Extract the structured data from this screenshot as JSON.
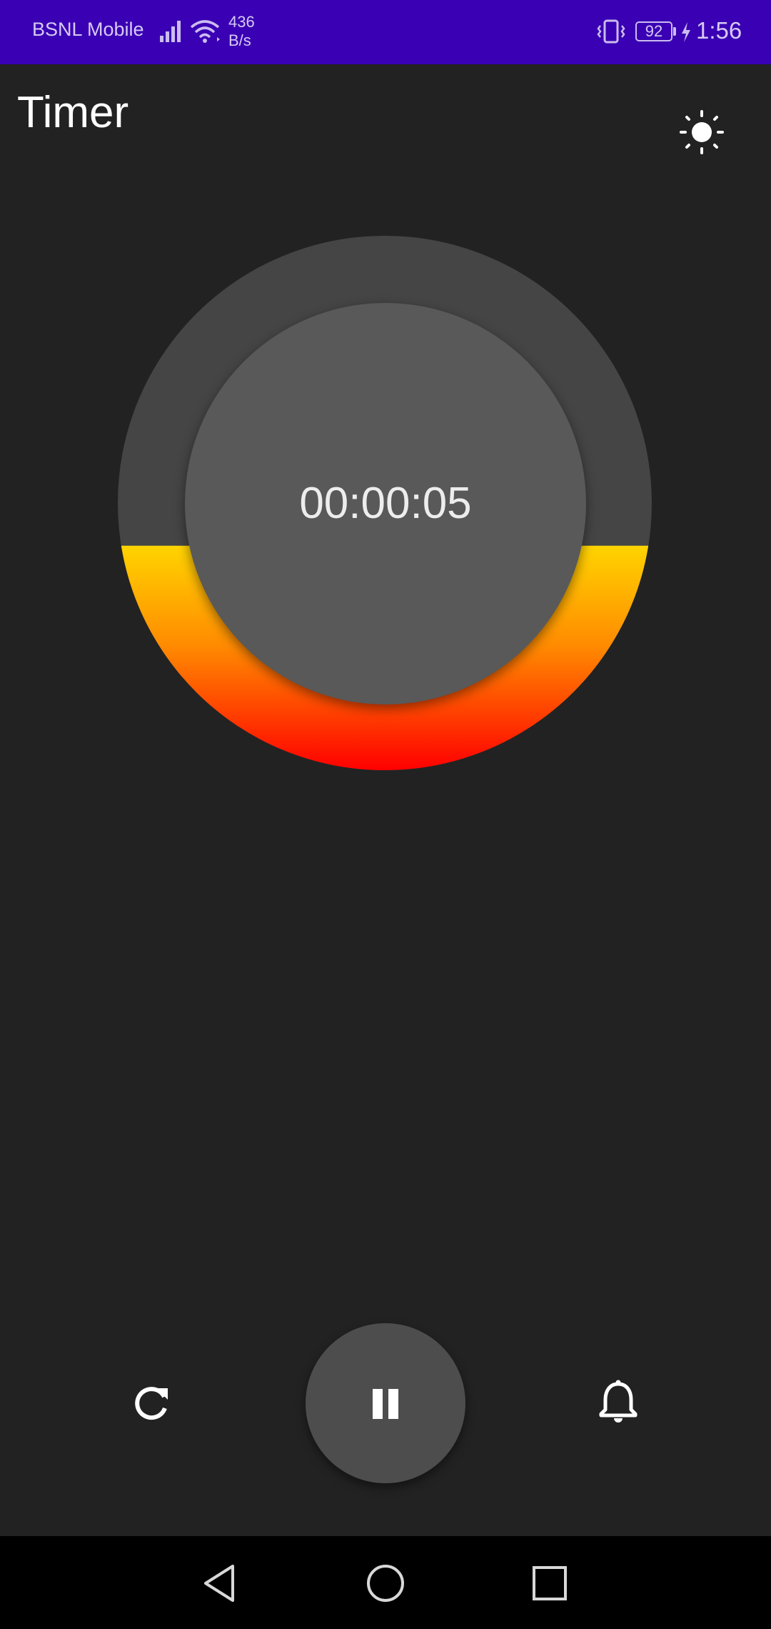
{
  "status_bar": {
    "carrier": "BSNL Mobile",
    "network_speed_value": "436",
    "network_speed_unit": "B/s",
    "battery_level": "92",
    "time": "1:56",
    "icons": [
      "signal-icon",
      "wifi-icon",
      "vibrate-icon",
      "battery-icon",
      "charging-bolt-icon"
    ],
    "background_color": "#3a00b3"
  },
  "app_bar": {
    "title": "Timer",
    "theme_icon": "sun-icon"
  },
  "timer": {
    "display": "00:00:05",
    "elapsed_fraction": 0.42,
    "progress_gradient": [
      "#ffd400",
      "#ff8a00",
      "#ff0000"
    ],
    "track_color": "#454545",
    "face_color": "#595959"
  },
  "controls": {
    "reset_icon": "refresh-icon",
    "pause_icon": "pause-icon",
    "alarm_icon": "bell-icon"
  },
  "nav_bar": {
    "icons": [
      "back-triangle-icon",
      "home-circle-icon",
      "recents-square-icon"
    ]
  }
}
